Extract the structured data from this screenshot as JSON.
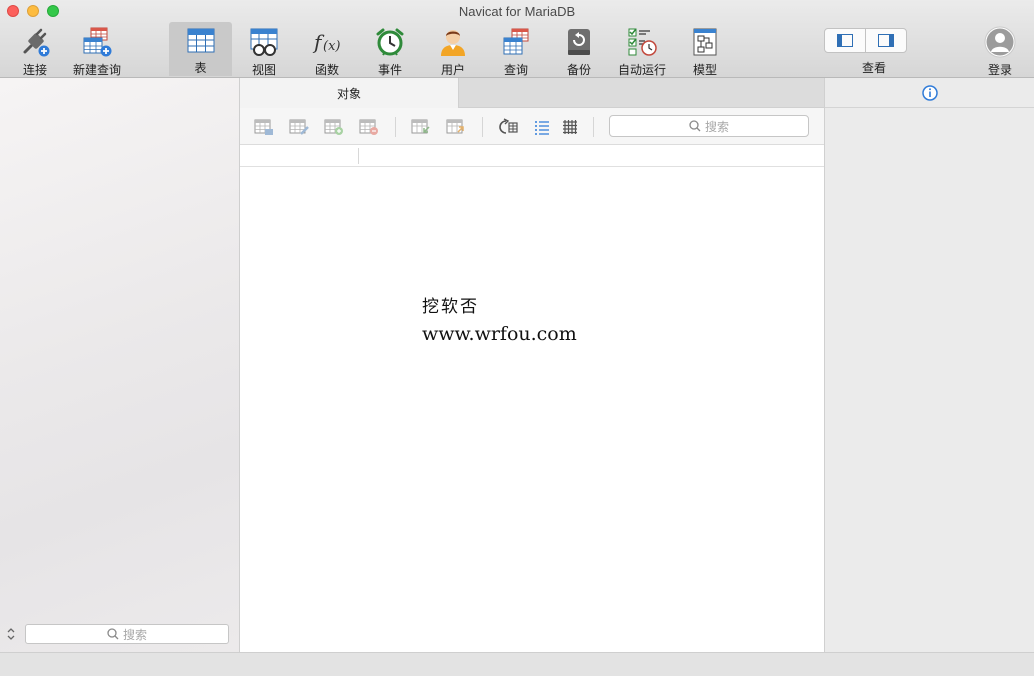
{
  "window": {
    "title": "Navicat for MariaDB"
  },
  "toolbar": {
    "items": [
      {
        "label": "连接",
        "icon": "plug-icon"
      },
      {
        "label": "新建查询",
        "icon": "new-query-icon"
      },
      {
        "label": "表",
        "icon": "table-icon",
        "active": true
      },
      {
        "label": "视图",
        "icon": "view-icon"
      },
      {
        "label": "函数",
        "icon": "function-icon"
      },
      {
        "label": "事件",
        "icon": "alarm-clock-icon"
      },
      {
        "label": "用户",
        "icon": "user-icon"
      },
      {
        "label": "查询",
        "icon": "query-icon"
      },
      {
        "label": "备份",
        "icon": "backup-icon"
      },
      {
        "label": "自动运行",
        "icon": "schedule-icon"
      },
      {
        "label": "模型",
        "icon": "model-icon"
      }
    ],
    "view_label": "查看",
    "login_label": "登录"
  },
  "sidebar": {
    "search_placeholder": "搜索"
  },
  "center": {
    "tab_label": "对象",
    "search_placeholder": "搜索",
    "watermark_cn": "挖软否",
    "watermark_url": "www.wrfou.com"
  },
  "colors": {
    "accent": "#2f7bd8",
    "toolbar_active": "#c9c9c9",
    "close": "#fc605c",
    "minimize": "#fdbc40",
    "maximize": "#34c84a"
  }
}
